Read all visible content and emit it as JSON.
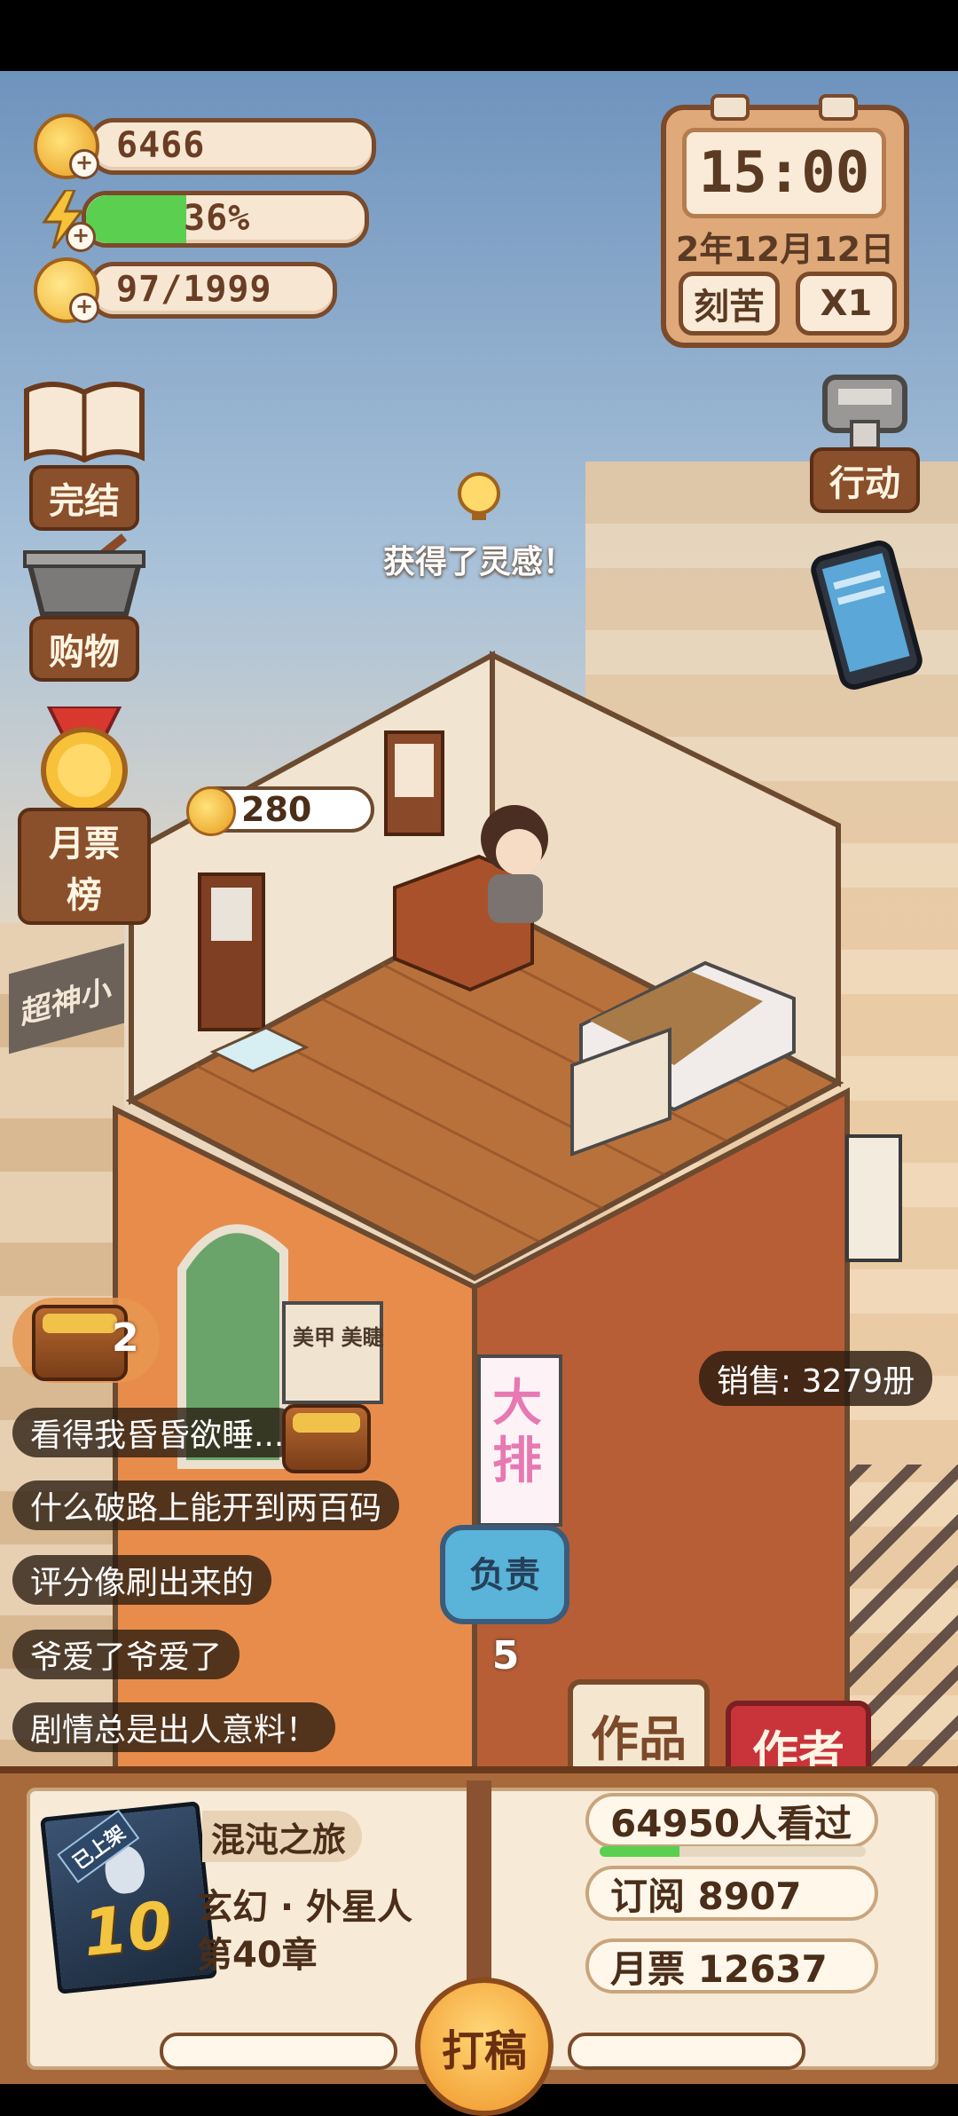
{
  "resources": {
    "coins": "6466",
    "energy_text": "36%",
    "energy_percent": 36,
    "inspiration": "97/1999"
  },
  "clock": {
    "time": "15:00",
    "date": "2年12月12日",
    "mode_label": "刻苦",
    "speed_label": "X1"
  },
  "side_menu": {
    "finish": "完结",
    "shop": "购物",
    "monthly_rank": "月票榜",
    "action": "行动"
  },
  "notice": {
    "text": "获得了灵感！"
  },
  "reward_bubble": {
    "value": "280"
  },
  "chest": {
    "count": "2"
  },
  "comments": [
    "看得我昏昏欲睡...",
    "什么破路上能开到两百码",
    "评分像刷出来的",
    "爷爱了爷爱了",
    "剧情总是出人意料！"
  ],
  "sales": {
    "text": "销售: 3279册"
  },
  "duty": {
    "label": "负责",
    "count": "5"
  },
  "tabs": {
    "works": "作品",
    "author": "作者"
  },
  "book": {
    "cover_tag": "已上架",
    "cover_number": "10",
    "title": "混沌之旅",
    "genre": "玄幻 · 外星人",
    "chapter": "第40章"
  },
  "stats": {
    "views": "64950人看过",
    "views_progress": 0.3,
    "subscribe": "订阅 8907",
    "monthly_ticket": "月票 12637"
  },
  "write_button": "打稿",
  "colors": {
    "brown_border": "#7a4a2a",
    "energy_green": "#5bcf4f",
    "author_red": "#c8343a",
    "duty_blue": "#5ab3d8"
  }
}
